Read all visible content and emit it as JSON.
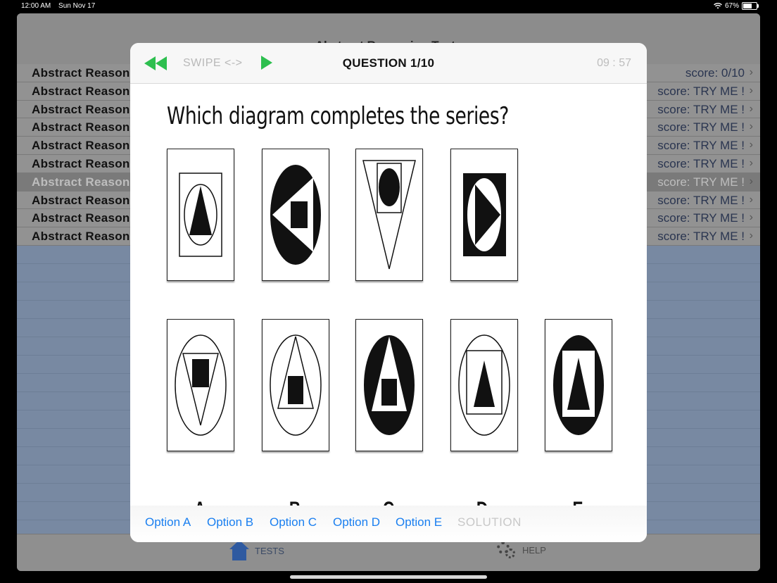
{
  "status": {
    "time": "12:00 AM",
    "date": "Sun Nov 17",
    "battery": "67%",
    "battery_level": 0.67
  },
  "app": {
    "title": "Abstract Reasoning Tests",
    "rows": [
      {
        "label": "Abstract Reasoning",
        "score": "score: 0/10"
      },
      {
        "label": "Abstract Reasoning",
        "score": "score: TRY ME !"
      },
      {
        "label": "Abstract Reasoning",
        "score": "score: TRY ME !"
      },
      {
        "label": "Abstract Reasoning",
        "score": "score: TRY ME !"
      },
      {
        "label": "Abstract Reasoning",
        "score": "score: TRY ME !"
      },
      {
        "label": "Abstract Reasoning",
        "score": "score: TRY ME !"
      },
      {
        "label": "Abstract Reasoning",
        "score": "score: TRY ME !"
      },
      {
        "label": "Abstract Reasoning",
        "score": "score: TRY ME !"
      },
      {
        "label": "Abstract Reasoning",
        "score": "score: TRY ME !"
      },
      {
        "label": "Abstract Reasoning",
        "score": "score: TRY ME !"
      }
    ],
    "tabs": {
      "tests": "TESTS",
      "help": "HELP"
    }
  },
  "modal": {
    "swipe": "SWIPE <->",
    "question_label": "QUESTION 1/10",
    "timer": "09 : 57",
    "question": "Which diagram completes the series?",
    "answer_letters": [
      "A",
      "B",
      "C",
      "D",
      "E"
    ],
    "options": [
      "Option A",
      "Option B",
      "Option C",
      "Option D",
      "Option E"
    ],
    "solution": "SOLUTION"
  },
  "colors": {
    "accent": "#1a7ff0",
    "play_green": "#2dbf4f"
  }
}
